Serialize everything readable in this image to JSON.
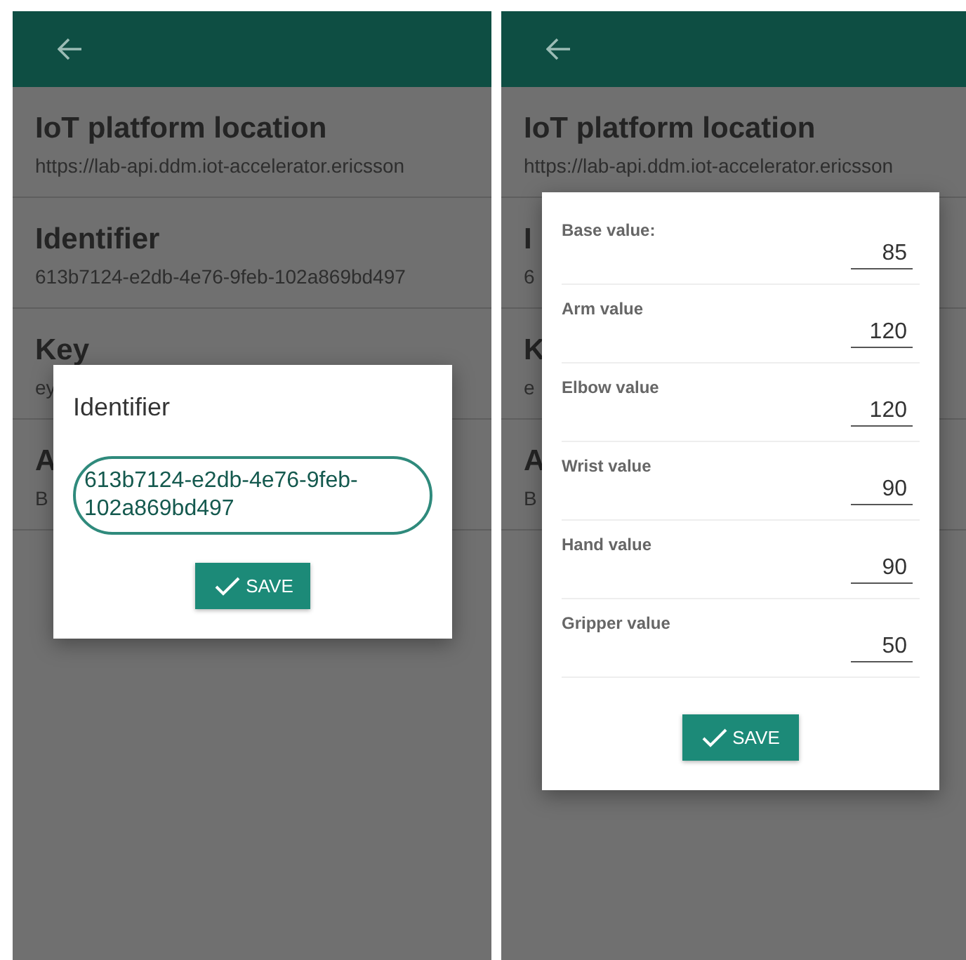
{
  "screens": [
    {
      "settings": [
        {
          "title": "IoT platform location",
          "value": "https://lab-api.ddm.iot-accelerator.ericsson"
        },
        {
          "title": "Identifier",
          "value": "613b7124-e2db-4e76-9feb-102a869bd497"
        },
        {
          "title": "Key",
          "value": "ey"
        },
        {
          "title": "A",
          "value": "B"
        }
      ],
      "dialog": {
        "kind": "text",
        "title": "Identifier",
        "value": "613b7124-e2db-4e76-9feb-102a869bd497",
        "button": "SAVE"
      }
    },
    {
      "settings": [
        {
          "title": "IoT platform location",
          "value": "https://lab-api.ddm.iot-accelerator.ericsson"
        },
        {
          "title": "I",
          "value": "6"
        },
        {
          "title": "K",
          "value": "e"
        },
        {
          "title": "A",
          "value": "B"
        }
      ],
      "dialog": {
        "kind": "form",
        "fields": [
          {
            "label": "Base value:",
            "value": "85"
          },
          {
            "label": "Arm value",
            "value": "120"
          },
          {
            "label": "Elbow value",
            "value": "120"
          },
          {
            "label": "Wrist value",
            "value": "90"
          },
          {
            "label": "Hand value",
            "value": "90"
          },
          {
            "label": "Gripper value",
            "value": "50"
          }
        ],
        "button": "SAVE"
      }
    }
  ]
}
